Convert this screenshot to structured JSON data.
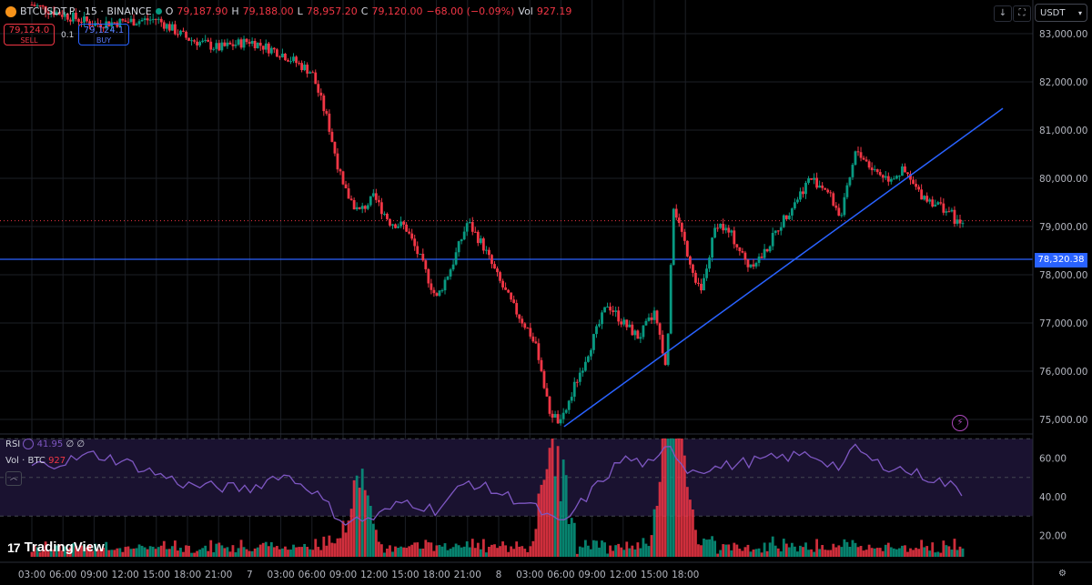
{
  "header": {
    "symbol": "BTCUSDT.P · 15 · BINANCE",
    "open_label": "O",
    "open": "79,187.90",
    "high_label": "H",
    "high": "79,188.00",
    "low_label": "L",
    "low": "78,957.20",
    "close_label": "C",
    "close": "79,120.00",
    "change": "−68.00 (−0.09%)",
    "vol_label": "Vol",
    "vol": "927.19"
  },
  "trade": {
    "sell_price": "79,124.0",
    "sell_label": "SELL",
    "spread": "0.1",
    "buy_price": "79,124.1",
    "buy_label": "BUY"
  },
  "toolbar": {
    "down_icon": "↓",
    "fullscreen_icon": "⛶"
  },
  "currency": {
    "label": "USDT",
    "chevron": "▾"
  },
  "price_tag": "78,320.38",
  "indicators": {
    "rsi_label": "RSI",
    "rsi_value": "41.95",
    "rsi_extra": "∅ ∅",
    "vol_label": "Vol · BTC",
    "vol_value": "927",
    "collapse_icon": "︿"
  },
  "logo": {
    "mark": "17",
    "text": "TradingView"
  },
  "settings_icon": "⚙",
  "flash_icon": "⚡",
  "colors": {
    "up": "#089981",
    "down": "#f23645",
    "trendline": "#2962ff",
    "rsi": "#7e57c2",
    "background": "#000000"
  },
  "chart_data": {
    "type": "candlestick",
    "interval": "15",
    "price_axis": {
      "ticks": [
        83000,
        82000,
        81000,
        80000,
        79000,
        78000,
        77000,
        76000,
        75000
      ],
      "tick_labels": [
        "83,000.00",
        "82,000.00",
        "81,000.00",
        "80,000.00",
        "79,000.00",
        "78,000.00",
        "77,000.00",
        "76,000.00",
        "75,000.00"
      ],
      "range": [
        74800,
        83300
      ]
    },
    "rsi_axis": {
      "ticks": [
        60,
        40,
        20
      ],
      "tick_labels": [
        "60.00",
        "40.00",
        "20.00"
      ],
      "bands": [
        70,
        50,
        30
      ]
    },
    "time_axis": {
      "labels": [
        "03:00",
        "06:00",
        "09:00",
        "12:00",
        "15:00",
        "18:00",
        "21:00",
        "7",
        "03:00",
        "06:00",
        "09:00",
        "12:00",
        "15:00",
        "18:00",
        "21:00",
        "8",
        "03:00",
        "06:00",
        "09:00",
        "12:00",
        "15:00",
        "18:00"
      ]
    },
    "last_price": 79120,
    "horizontal_line": 78320.38,
    "trendline": {
      "start": [
        "7 12:15",
        74850
      ],
      "end": [
        "8 14:00",
        81450
      ]
    },
    "price_path": [
      [
        0,
        83600
      ],
      [
        2,
        83200
      ],
      [
        4,
        83300
      ],
      [
        5,
        82900
      ],
      [
        6,
        82700
      ],
      [
        7,
        82850
      ],
      [
        8,
        82600
      ],
      [
        9,
        82200
      ],
      [
        9.5,
        81200
      ],
      [
        10,
        79800
      ],
      [
        10.5,
        79300
      ],
      [
        11,
        79600
      ],
      [
        11.5,
        79100
      ],
      [
        12,
        79000
      ],
      [
        12.5,
        78300
      ],
      [
        13,
        77500
      ],
      [
        13.5,
        78200
      ],
      [
        14,
        79100
      ],
      [
        14.5,
        78600
      ],
      [
        15,
        77900
      ],
      [
        15.5,
        77300
      ],
      [
        16,
        76800
      ],
      [
        16.3,
        76300
      ],
      [
        16.6,
        75200
      ],
      [
        17,
        74900
      ],
      [
        17.5,
        75800
      ],
      [
        18,
        76600
      ],
      [
        18.5,
        77400
      ],
      [
        19,
        77000
      ],
      [
        19.5,
        76700
      ],
      [
        20,
        77200
      ],
      [
        20.4,
        76000
      ],
      [
        20.6,
        79500
      ],
      [
        21,
        78600
      ],
      [
        21.5,
        77600
      ],
      [
        22,
        79100
      ],
      [
        22.5,
        78800
      ],
      [
        23,
        78200
      ],
      [
        23.5,
        78400
      ],
      [
        24,
        79000
      ],
      [
        24.5,
        79500
      ],
      [
        25,
        80000
      ],
      [
        25.5,
        79800
      ],
      [
        26,
        79200
      ],
      [
        26.5,
        80600
      ],
      [
        27,
        80200
      ],
      [
        27.5,
        80000
      ],
      [
        28,
        80150
      ],
      [
        28.5,
        79700
      ],
      [
        29,
        79500
      ],
      [
        29.5,
        79300
      ],
      [
        29.8,
        79000
      ],
      [
        30,
        79120
      ]
    ],
    "rsi_path": [
      [
        0,
        56
      ],
      [
        1,
        58
      ],
      [
        2,
        62
      ],
      [
        3,
        58
      ],
      [
        4,
        52
      ],
      [
        5,
        46
      ],
      [
        6,
        45
      ],
      [
        7,
        44
      ],
      [
        8,
        52
      ],
      [
        9,
        44
      ],
      [
        10,
        27
      ],
      [
        11,
        29
      ],
      [
        12,
        38
      ],
      [
        13,
        33
      ],
      [
        14,
        48
      ],
      [
        15,
        42
      ],
      [
        16,
        36
      ],
      [
        17,
        25
      ],
      [
        18,
        43
      ],
      [
        19,
        60
      ],
      [
        20,
        56
      ],
      [
        20.5,
        68
      ],
      [
        21,
        54
      ],
      [
        22,
        55
      ],
      [
        23,
        58
      ],
      [
        24,
        60
      ],
      [
        25,
        62
      ],
      [
        26,
        55
      ],
      [
        26.5,
        66
      ],
      [
        27,
        58
      ],
      [
        28,
        54
      ],
      [
        29,
        49
      ],
      [
        29.5,
        46
      ],
      [
        30,
        41.95
      ]
    ],
    "volume_spikes": [
      [
        10.5,
        0.55
      ],
      [
        16.8,
        0.95
      ],
      [
        20.5,
        0.85
      ],
      [
        20.8,
        0.6
      ]
    ]
  }
}
